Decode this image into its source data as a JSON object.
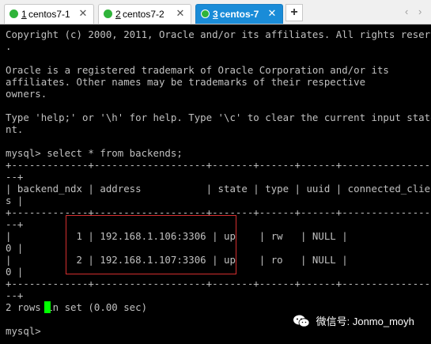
{
  "tabs": [
    {
      "number": "1",
      "name": "centos7-1",
      "close": "✕"
    },
    {
      "number": "2",
      "name": "centos7-2",
      "close": "✕"
    },
    {
      "number": "3",
      "name": "centos-7",
      "close": "✕"
    }
  ],
  "new_tab_label": "+",
  "nav": {
    "prev": "‹",
    "next": "›"
  },
  "colors": {
    "active_tab": "#1a8cd8",
    "status_dot": "#2fb43a",
    "cursor": "#00ff00",
    "highlight_border": "#d32f2f"
  },
  "terminal": {
    "text": "Copyright (c) 2000, 2011, Oracle and/or its affiliates. All rights reserved\n.\n\nOracle is a registered trademark of Oracle Corporation and/or its\naffiliates. Other names may be trademarks of their respective\nowners.\n\nType 'help;' or '\\h' for help. Type '\\c' to clear the current input stateme\nnt.\n\nmysql> select * from backends;\n+-------------+-------------------+-------+------+------+------------------\n--+\n| backend_ndx | address           | state | type | uuid | connected_client\ns |\n+-------------+-------------------+-------+------+------+------------------\n--+\n|           1 | 192.168.1.106:3306 | up    | rw   | NULL |\n0 |\n|           2 | 192.168.1.107:3306 | up    | ro   | NULL |\n0 |\n+-------------+-------------------+-------+------+------+------------------\n--+\n2 rows in set (0.00 sec)\n\nmysql> "
  },
  "watermark": {
    "icon": "wechat-icon",
    "text": "微信号: Jonmo_moyh"
  }
}
